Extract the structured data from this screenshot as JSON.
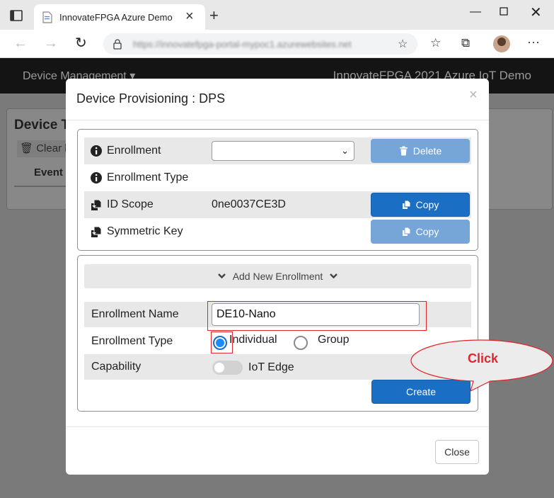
{
  "browser": {
    "tab_title": "InnovateFPGA Azure Demo",
    "url": "https://innovatefpga-portal-mypoc1.azurewebsites.net"
  },
  "app": {
    "nav_left": "Device Management ▾",
    "nav_right": "InnovateFPGA 2021 Azure IoT Demo",
    "card_title": "Device T",
    "clear_label": "Clear l",
    "events_label": "Event"
  },
  "modal": {
    "title": "Device Provisioning : DPS",
    "close_x": "×",
    "enrollment_label": "Enrollment",
    "enrollment_selected": "",
    "delete_label": "Delete",
    "enrollment_type_label": "Enrollment Type",
    "id_scope_label": "ID Scope",
    "id_scope_value": "0ne0037CE3D",
    "copy_label": "Copy",
    "symmetric_key_label": "Symmetric Key",
    "add_new_enrollment": "Add New Enrollment",
    "form": {
      "enrollment_name_label": "Enrollment Name",
      "enrollment_name_value": "DE10-Nano",
      "enrollment_type_label": "Enrollment Type",
      "type_options": [
        "Individual",
        "Group"
      ],
      "type_selected": "Individual",
      "capability_label": "Capability",
      "iot_edge_label": "IoT Edge",
      "iot_edge_enabled": false,
      "create_label": "Create"
    },
    "close_label": "Close"
  },
  "annotation": {
    "callout_text": "Click",
    "highlight_color": "#e0262b"
  },
  "colors": {
    "primary": "#1a6fc4",
    "primary_disabled": "#76a6d8",
    "row_shade": "#e8e8e8"
  }
}
